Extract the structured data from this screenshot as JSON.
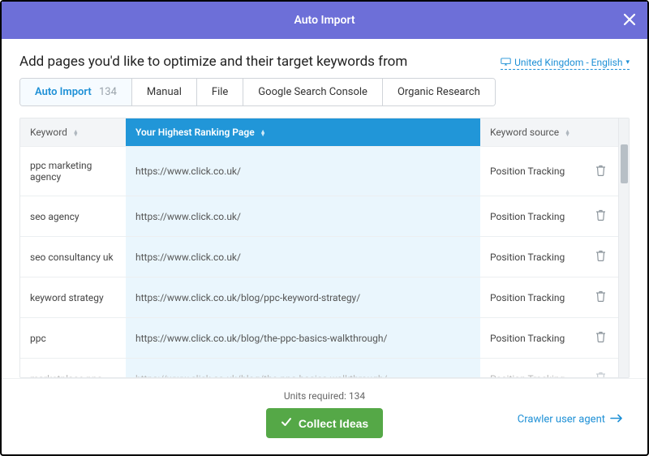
{
  "header": {
    "title": "Auto Import"
  },
  "subhead": "Add pages you'd like to optimize and their target keywords from",
  "locale": "United Kingdom - English",
  "tabs": [
    {
      "label": "Auto Import",
      "count": "134",
      "active": true
    },
    {
      "label": "Manual",
      "active": false
    },
    {
      "label": "File",
      "active": false
    },
    {
      "label": "Google Search Console",
      "active": false
    },
    {
      "label": "Organic Research",
      "active": false
    }
  ],
  "columns": {
    "keyword": "Keyword",
    "page": "Your Highest Ranking Page",
    "source": "Keyword source"
  },
  "rows": [
    {
      "keyword": "ppc marketing agency",
      "page": "https://www.click.co.uk/",
      "source": "Position Tracking"
    },
    {
      "keyword": "seo agency",
      "page": "https://www.click.co.uk/",
      "source": "Position Tracking"
    },
    {
      "keyword": "seo consultancy uk",
      "page": "https://www.click.co.uk/",
      "source": "Position Tracking"
    },
    {
      "keyword": "keyword strategy",
      "page": "https://www.click.co.uk/blog/ppc-keyword-strategy/",
      "source": "Position Tracking"
    },
    {
      "keyword": "ppc",
      "page": "https://www.click.co.uk/blog/the-ppc-basics-walkthrough/",
      "source": "Position Tracking"
    },
    {
      "keyword": "marketplace ppc",
      "page": "https://www.click.co.uk/blog/the-ppc-basics-walkthrough/",
      "source": "Position Tracking"
    }
  ],
  "footer": {
    "units_label": "Units required: 134",
    "collect_label": "Collect Ideas",
    "crawler_label": "Crawler user agent"
  }
}
